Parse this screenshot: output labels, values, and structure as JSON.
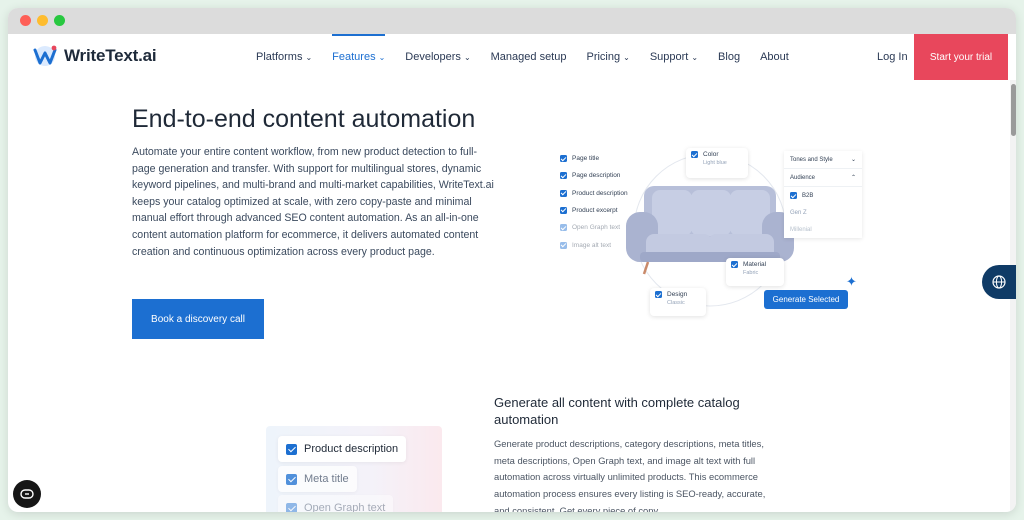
{
  "brand": {
    "name": "WriteText.ai",
    "primary": "#1c6fd1",
    "accent": "#e8475c"
  },
  "nav": {
    "items": [
      {
        "label": "Platforms",
        "dropdown": true,
        "active": false
      },
      {
        "label": "Features",
        "dropdown": true,
        "active": true
      },
      {
        "label": "Developers",
        "dropdown": true,
        "active": false
      },
      {
        "label": "Managed setup",
        "dropdown": false,
        "active": false
      },
      {
        "label": "Pricing",
        "dropdown": true,
        "active": false
      },
      {
        "label": "Support",
        "dropdown": true,
        "active": false
      },
      {
        "label": "Blog",
        "dropdown": false,
        "active": false
      },
      {
        "label": "About",
        "dropdown": false,
        "active": false
      }
    ],
    "login": "Log In",
    "trial": "Start your trial"
  },
  "hero": {
    "title": "End-to-end content automation",
    "text": "Automate your entire content workflow, from new product detection to full-page generation and transfer. With support for multilingual stores, dynamic keyword pipelines, and multi-brand and multi-market capabilities, WriteText.ai keeps your catalog optimized at scale, with zero copy-paste and minimal manual effort through advanced SEO content automation. As an all-in-one content automation platform for ecommerce, it delivers automated content creation and continuous optimization across every product page.",
    "cta": "Book a discovery call"
  },
  "illustration": {
    "checklist": [
      "Page title",
      "Page description",
      "Product description",
      "Product excerpt",
      "Open Graph text",
      "Image alt text"
    ],
    "color_card": {
      "label": "Color",
      "value": "Light blue"
    },
    "material_card": {
      "label": "Material",
      "value": "Fabric"
    },
    "design_card": {
      "label": "Design",
      "value": "Classic"
    },
    "tones_label": "Tones and Style",
    "audience_label": "Audience",
    "audience_options": [
      "B2B",
      "Gen Z",
      "Millenial"
    ],
    "generate_button": "Generate Selected"
  },
  "section2": {
    "title": "Generate all content with complete catalog automation",
    "text": "Generate product descriptions, category descriptions, meta titles, meta descriptions, Open Graph text, and image alt text with full automation across virtually unlimited products. This ecommerce automation process ensures every listing is SEO-ready, accurate, and consistent. Get every piece of copy",
    "pills": [
      "Product description",
      "Meta title",
      "Open Graph text"
    ]
  }
}
